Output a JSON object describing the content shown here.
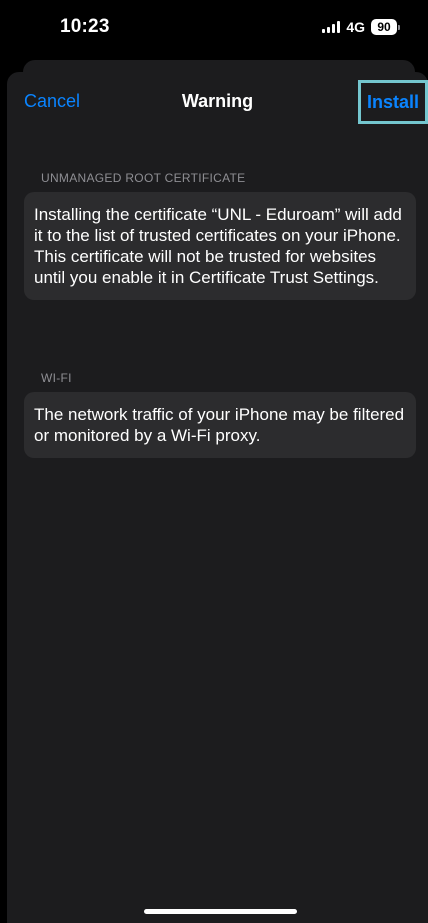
{
  "status_bar": {
    "time": "10:23",
    "network": "4G",
    "battery": "90"
  },
  "nav": {
    "cancel_label": "Cancel",
    "title": "Warning",
    "install_label": "Install",
    "highlight_color": "#74c6cf",
    "accent_color": "#0a84ff"
  },
  "sections": {
    "root_certificate": {
      "header": "UNMANAGED ROOT CERTIFICATE",
      "body": "Installing the certificate “UNL - Eduroam” will add it to the list of trusted certificates on your iPhone. This certificate will not be trusted for websites until you enable it in Certificate Trust Settings."
    },
    "wifi": {
      "header": "WI-FI",
      "body": "The network traffic of your iPhone may be filtered or monitored by a Wi-Fi proxy."
    }
  }
}
